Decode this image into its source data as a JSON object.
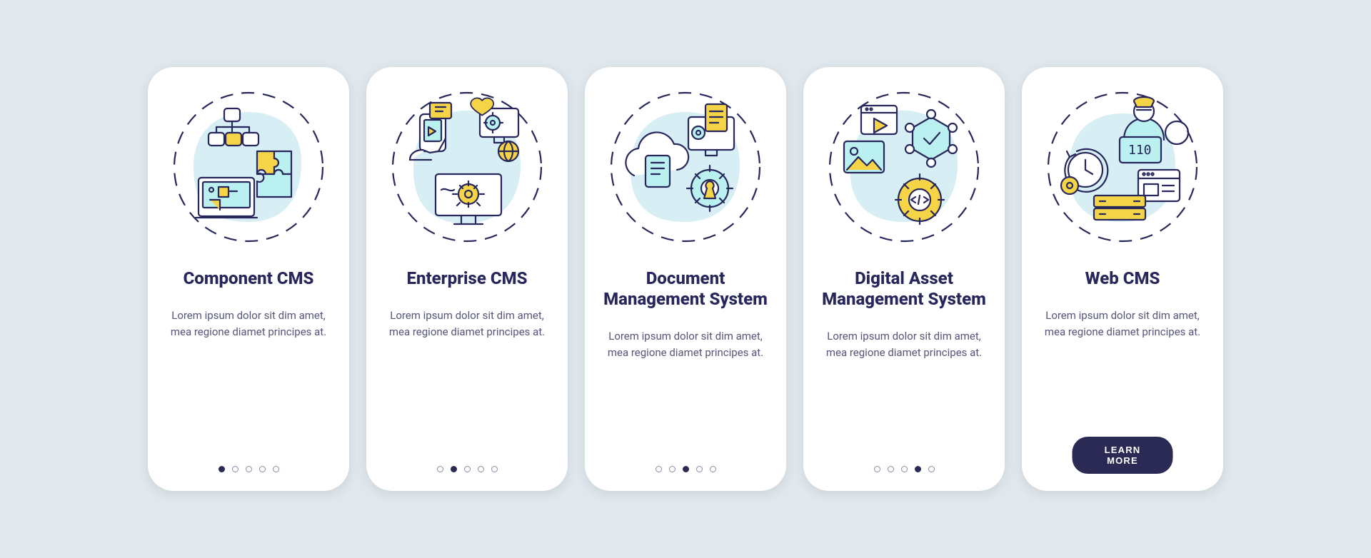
{
  "colors": {
    "accentYellow": "#f5d547",
    "accentCyan": "#baf0f0",
    "bgBlob": "#d6eef4",
    "ink": "#27275b",
    "ctaBg": "#2a2a55",
    "pageBg": "#e1e9ee"
  },
  "lorem": "Lorem ipsum dolor sit dim amet, mea regione diamet principes at.",
  "cards": [
    {
      "title": "Component CMS",
      "icon": "component-cms-icon",
      "activeDot": 0,
      "hasDots": true
    },
    {
      "title": "Enterprise CMS",
      "icon": "enterprise-cms-icon",
      "activeDot": 1,
      "hasDots": true
    },
    {
      "title": "Document Management System",
      "icon": "document-management-icon",
      "activeDot": 2,
      "hasDots": true
    },
    {
      "title": "Digital Asset Management System",
      "icon": "digital-asset-icon",
      "activeDot": 3,
      "hasDots": true
    },
    {
      "title": "Web CMS",
      "icon": "web-cms-icon",
      "activeDot": 4,
      "hasDots": false,
      "ctaLabel": "LEARN MORE"
    }
  ],
  "dotCount": 5
}
